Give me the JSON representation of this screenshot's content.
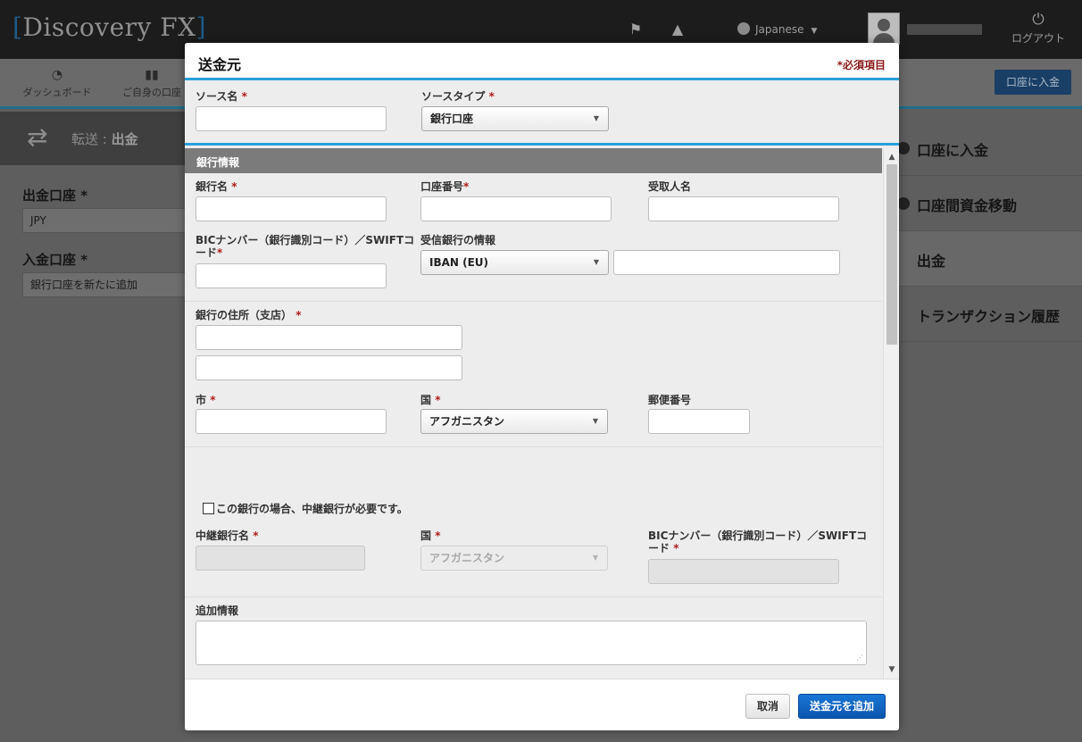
{
  "app": {
    "logo_text": "Discovery FX",
    "language": "Japanese",
    "logout_label": "ログアウト",
    "deposit_button": "口座に入金"
  },
  "nav": {
    "items": [
      {
        "label": "ダッシュボード",
        "icon": "gauge-icon"
      },
      {
        "label": "ご自身の口座",
        "icon": "bar-chart-icon"
      }
    ]
  },
  "page": {
    "title_prefix": "転送 : ",
    "title_main": "出金",
    "from_label": "出金口座",
    "from_value": "JPY",
    "to_label": "入金口座",
    "to_value": "銀行口座を新たに追加",
    "required_mark": "*"
  },
  "side_menu": {
    "items": [
      {
        "label": "口座に入金"
      },
      {
        "label": "口座間資金移動"
      },
      {
        "label": "出金"
      },
      {
        "label": "トランザクション履歴"
      }
    ]
  },
  "modal": {
    "title": "送金元",
    "required_note": "*必須項目",
    "source_name_label": "ソース名",
    "source_type_label": "ソースタイプ",
    "source_type_value": "銀行口座",
    "bank_info_section": "銀行情報",
    "bank_name_label": "銀行名",
    "account_number_label": "口座番号",
    "payee_name_label": "受取人名",
    "bic_label": "BICナンバー（銀行識別コード）／SWIFTコード",
    "receiving_bank_label": "受信銀行の情報",
    "receiving_bank_value": "IBAN (EU)",
    "bank_address_label": "銀行の住所（支店）",
    "city_label": "市",
    "country_label": "国",
    "country_value": "アフガニスタン",
    "postal_label": "郵便番号",
    "intermediary_checkbox_label": "この銀行の場合、中継銀行が必要です。",
    "intermediary_name_label": "中継銀行名",
    "intermediary_country_label": "国",
    "intermediary_country_value": "アフガニスタン",
    "intermediary_bic_label": "BICナンバー（銀行識別コード）／SWIFTコード",
    "additional_info_label": "追加情報",
    "cancel_button": "取消",
    "add_button": "送金元を追加",
    "req": "*"
  },
  "colors": {
    "accent_blue": "#27a0db",
    "primary_button": "#0b55ad",
    "required_red": "#b01c1c"
  }
}
